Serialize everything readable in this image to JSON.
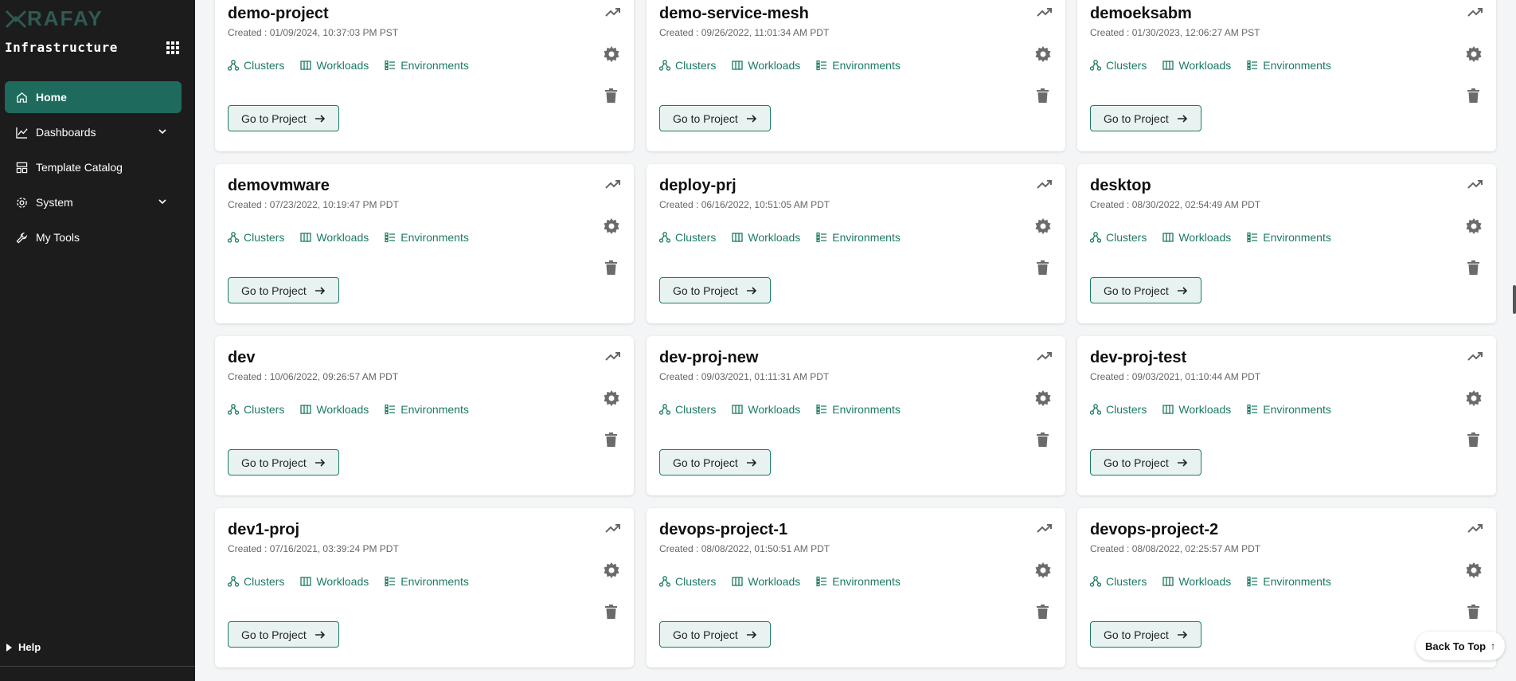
{
  "brand": {
    "logo_text": "RAFAY",
    "app_title": "Infrastructure"
  },
  "sidebar": {
    "items": [
      {
        "label": "Home",
        "icon": "home-icon",
        "active": true
      },
      {
        "label": "Dashboards",
        "icon": "chart-icon",
        "expandable": true
      },
      {
        "label": "Template Catalog",
        "icon": "catalog-icon"
      },
      {
        "label": "System",
        "icon": "gear-icon",
        "expandable": true
      },
      {
        "label": "My Tools",
        "icon": "wrench-icon"
      }
    ],
    "help_label": "Help"
  },
  "card_labels": {
    "clusters": "Clusters",
    "workloads": "Workloads",
    "environments": "Environments",
    "go_to_project": "Go to Project"
  },
  "projects": [
    {
      "name": "demo-project",
      "created": "Created : 01/09/2024, 10:37:03 PM PST"
    },
    {
      "name": "demo-service-mesh",
      "created": "Created : 09/26/2022, 11:01:34 AM PDT"
    },
    {
      "name": "demoeksabm",
      "created": "Created : 01/30/2023, 12:06:27 AM PST"
    },
    {
      "name": "demovmware",
      "created": "Created : 07/23/2022, 10:19:47 PM PDT"
    },
    {
      "name": "deploy-prj",
      "created": "Created : 06/16/2022, 10:51:05 AM PDT"
    },
    {
      "name": "desktop",
      "created": "Created : 08/30/2022, 02:54:49 AM PDT"
    },
    {
      "name": "dev",
      "created": "Created : 10/06/2022, 09:26:57 AM PDT"
    },
    {
      "name": "dev-proj-new",
      "created": "Created : 09/03/2021, 01:11:31 AM PDT"
    },
    {
      "name": "dev-proj-test",
      "created": "Created : 09/03/2021, 01:10:44 AM PDT"
    },
    {
      "name": "dev1-proj",
      "created": "Created : 07/16/2021, 03:39:24 PM PDT"
    },
    {
      "name": "devops-project-1",
      "created": "Created : 08/08/2022, 01:50:51 AM PDT"
    },
    {
      "name": "devops-project-2",
      "created": "Created : 08/08/2022, 02:25:57 AM PDT"
    }
  ],
  "back_to_top": "Back To Top",
  "colors": {
    "accent": "#1b7a65",
    "sidebar_bg": "#1c1c1c",
    "active_nav": "#1e6b5d"
  }
}
